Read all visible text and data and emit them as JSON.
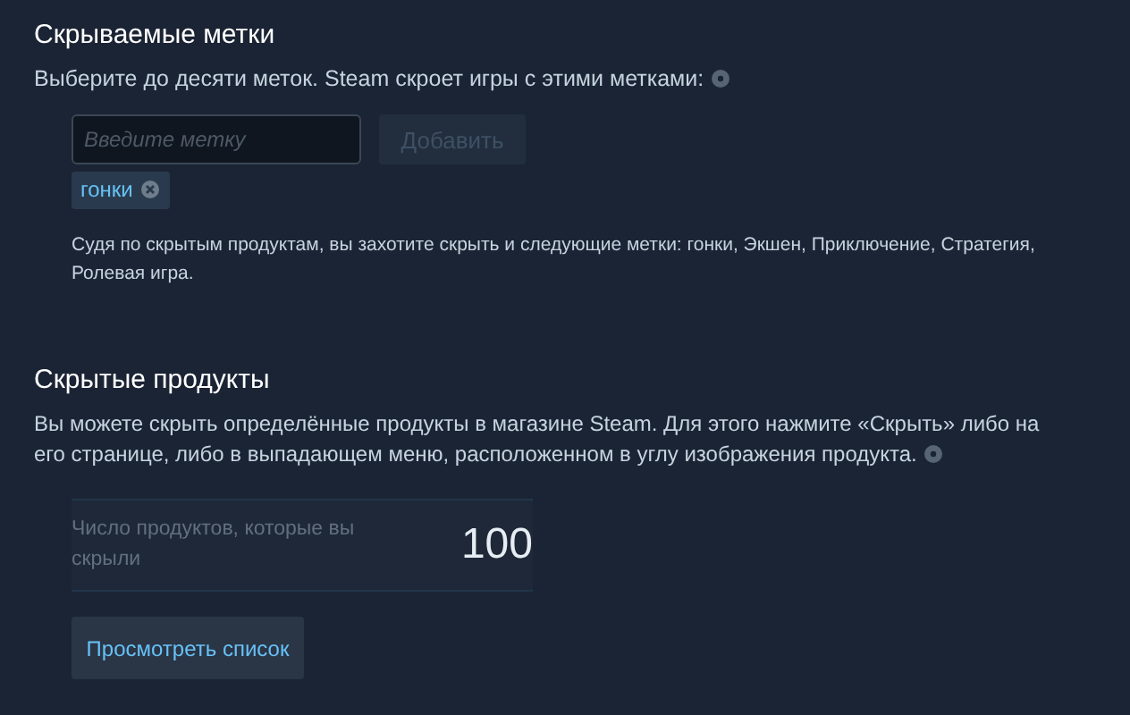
{
  "hidden_tags": {
    "title": "Скрываемые метки",
    "description": "Выберите до десяти меток. Steam скроет игры с этими метками:",
    "input": {
      "placeholder": "Введите метку"
    },
    "add_button": {
      "label": "Добавить",
      "disabled": true
    },
    "tags": [
      {
        "label": "гонки"
      }
    ],
    "suggestion": "Судя по скрытым продуктам, вы захотите скрыть и следующие метки: гонки, Экшен, Приключение, Стратегия, Ролевая игра."
  },
  "hidden_products": {
    "title": "Скрытые продукты",
    "description": "Вы можете скрыть определённые продукты в магазине Steam. Для этого нажмите «Скрыть» либо на его странице, либо в выпадающем меню, расположенном в углу изображения продукта.",
    "stat": {
      "label": "Число продуктов, которые вы скрыли",
      "value": "100"
    },
    "view_button": {
      "label": "Просмотреть список"
    }
  }
}
